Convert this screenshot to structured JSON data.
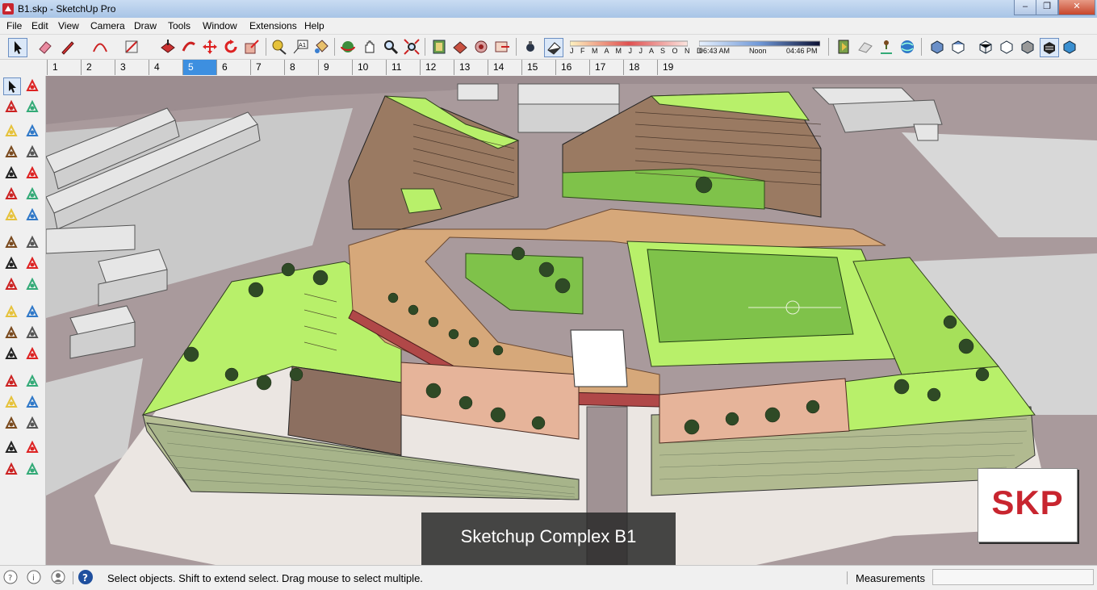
{
  "window": {
    "title": "B1.skp - SketchUp Pro"
  },
  "menu": [
    "File",
    "Edit",
    "View",
    "Camera",
    "Draw",
    "Tools",
    "Window",
    "Extensions",
    "Help"
  ],
  "toolbar": {
    "icons": [
      "select-tool-icon",
      "eraser-icon",
      "pencil-line-icon",
      "arc-icon",
      "rectangle-icon",
      "push-pull-icon",
      "follow-me-icon",
      "move-icon",
      "rotate-icon",
      "scale-icon",
      "tape-measure-icon",
      "text-icon",
      "paint-bucket-icon",
      "orbit-icon",
      "pan-icon",
      "zoom-icon",
      "zoom-extents-icon",
      "component-icon",
      "material-icon",
      "warehouse-icon",
      "share-icon",
      "shadows-icon",
      "display-shadows-icon"
    ],
    "shadow_months": "J F M A M J J A S O N D",
    "time_start": "06:43 AM",
    "time_mid": "Noon",
    "time_end": "04:46 PM",
    "style_icons": [
      "section-plane-icon",
      "section-cut-icon",
      "terrain-icon",
      "globe-icon",
      "iso-view-icon",
      "top-view-icon",
      "xray-icon",
      "wireframe-icon",
      "hidden-line-icon",
      "shaded-icon",
      "shaded-texture-icon",
      "monochrome-icon"
    ]
  },
  "scene_tabs": [
    "1",
    "2",
    "3",
    "4",
    "5",
    "6",
    "7",
    "8",
    "9",
    "10",
    "11",
    "12",
    "13",
    "14",
    "15",
    "16",
    "17",
    "18",
    "19"
  ],
  "active_scene": "5",
  "left_tools": [
    "select-icon",
    "component-icon",
    "paint-icon",
    "eraser-icon",
    "line-icon",
    "freehand-icon",
    "rectangle-icon",
    "rotated-rect-icon",
    "circle-icon",
    "polygon-icon",
    "arc-icon",
    "arc-2pt-icon",
    "arc-3pt-icon",
    "pie-icon",
    "move-icon",
    "push-pull-icon",
    "rotate-icon",
    "follow-me-icon",
    "scale-icon",
    "offset-icon",
    "tape-measure-icon",
    "dimension-icon",
    "protractor-icon",
    "text-icon",
    "axes-icon",
    "3d-text-icon",
    "orbit-icon",
    "pan-icon",
    "zoom-icon",
    "zoom-window-icon",
    "zoom-extents-icon",
    "previous-view-icon",
    "position-camera-icon",
    "look-around-icon",
    "walk-icon",
    "section-plane-icon"
  ],
  "viewport": {
    "caption": "Sketchup Complex B1",
    "badge": "SKP"
  },
  "status": {
    "hint": "Select objects. Shift to extend select. Drag mouse to select multiple.",
    "measurements_label": "Measurements",
    "measurements_value": ""
  },
  "colors": {
    "roof_green": "#b8f06a",
    "lawn_green": "#7fc24a",
    "plaza_wood": "#d6a87a",
    "road": "#9a8a8c",
    "paving": "#ece6e0",
    "facade": "#a9b58a",
    "skp_red": "#c8252f"
  }
}
